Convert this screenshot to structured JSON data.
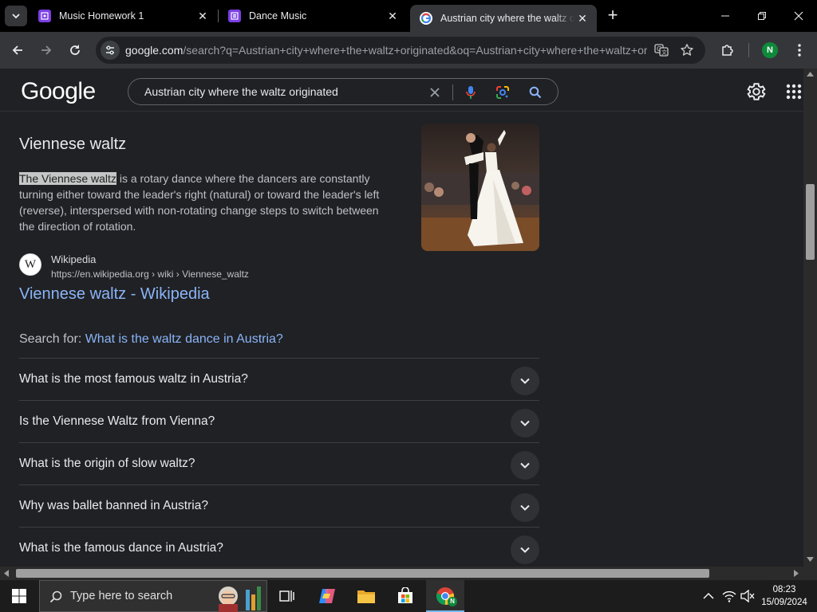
{
  "browser": {
    "tabs": [
      {
        "title": "Music Homework 1",
        "icon": "forms-icon",
        "active": false
      },
      {
        "title": "Dance Music",
        "icon": "forms-icon",
        "active": false
      },
      {
        "title": "Austrian city where the waltz originated - Google Search",
        "icon": "google-icon",
        "active": true
      }
    ],
    "url_host": "google.com",
    "url_path": "/search?q=Austrian+city+where+the+waltz+originated&oq=Austrian+city+where+the+waltz+originated",
    "profile_initial": "N"
  },
  "google": {
    "logo": "Google",
    "query": "Austrian city where the waltz originated"
  },
  "knowledge": {
    "title": "Viennese waltz",
    "snippet_highlight": "The Viennese waltz",
    "snippet_rest": " is a rotary dance where the dancers are constantly turning either toward the leader's right (natural) or toward the leader's left (reverse), interspersed with non-rotating change steps to switch between the direction of rotation.",
    "source_name": "Wikipedia",
    "source_url": "https://en.wikipedia.org › wiki › Viennese_waltz",
    "result_title": "Viennese waltz - Wikipedia",
    "favicon_letter": "W"
  },
  "search_for": {
    "label": "Search for: ",
    "link": "What is the waltz dance in Austria?"
  },
  "people_also_ask": [
    "What is the most famous waltz in Austria?",
    "Is the Viennese Waltz from Vienna?",
    "What is the origin of slow waltz?",
    "Why was ballet banned in Austria?",
    "What is the famous dance in Austria?"
  ],
  "taskbar": {
    "search_placeholder": "Type here to search",
    "time": "08:23",
    "date": "15/09/2024"
  },
  "colors": {
    "link": "#8ab4f8",
    "forms_purple": "#7b3fe4",
    "profile_green": "#0e8a3a"
  }
}
